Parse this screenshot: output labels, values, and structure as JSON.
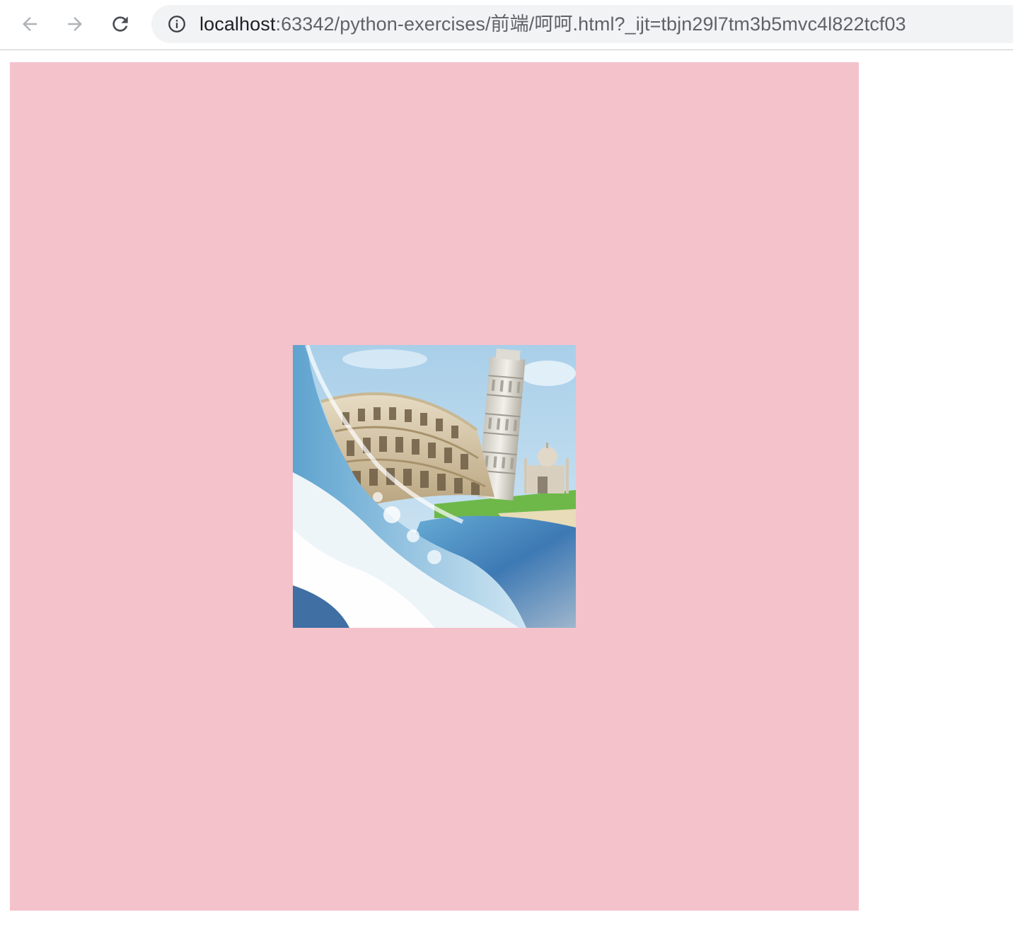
{
  "browser": {
    "back_icon": "arrow-left-icon",
    "forward_icon": "arrow-right-icon",
    "reload_icon": "reload-icon",
    "site_info_icon": "info-icon",
    "url": {
      "host": "localhost",
      "rest": ":63342/python-exercises/前端/呵呵.html?_ijt=tbjn29l7tm3b5mvc4l822tcf03"
    }
  },
  "page": {
    "background_color": "#f4c2cb",
    "image": {
      "subject": "landmarks-collage",
      "elements": [
        "colosseum",
        "leaning-tower-of-pisa",
        "taj-mahal",
        "ocean-wave"
      ]
    }
  }
}
